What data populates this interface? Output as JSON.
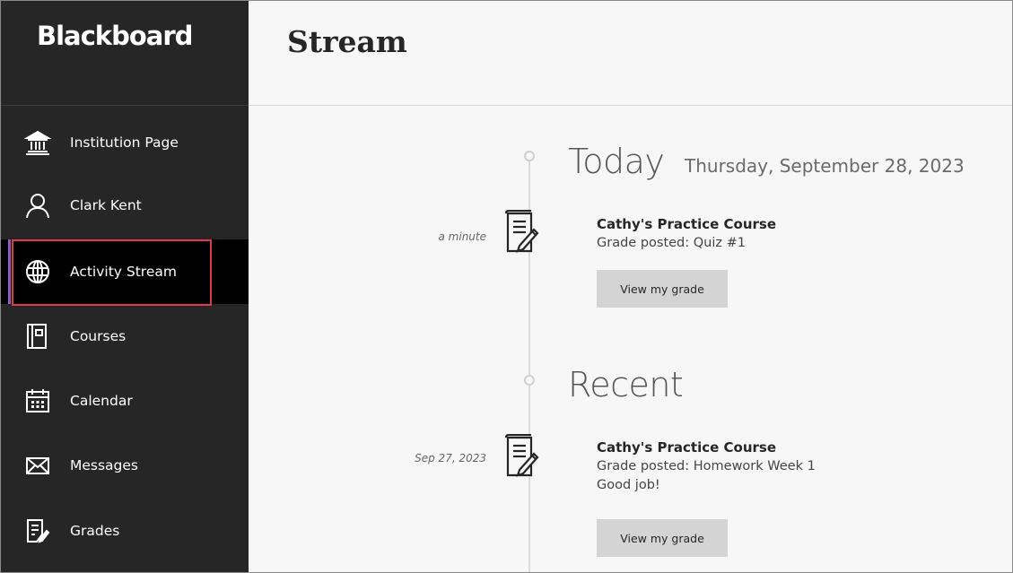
{
  "brand": {
    "name": "Blackboard"
  },
  "sidebar": {
    "items": [
      {
        "label": "Institution Page",
        "icon": "institution-icon"
      },
      {
        "label": "Clark Kent",
        "icon": "user-icon"
      },
      {
        "label": "Activity Stream",
        "icon": "globe-icon",
        "active": true
      },
      {
        "label": "Courses",
        "icon": "courses-icon"
      },
      {
        "label": "Calendar",
        "icon": "calendar-icon"
      },
      {
        "label": "Messages",
        "icon": "envelope-icon"
      },
      {
        "label": "Grades",
        "icon": "grades-icon"
      }
    ]
  },
  "header": {
    "title": "Stream"
  },
  "stream": {
    "today": {
      "title": "Today",
      "date": "Thursday, September 28, 2023",
      "item": {
        "time": "a minute",
        "course": "Cathy's Practice Course",
        "text": "Grade posted: Quiz #1",
        "button": "View my grade"
      }
    },
    "recent": {
      "title": "Recent",
      "item": {
        "time": "Sep 27, 2023",
        "course": "Cathy's Practice Course",
        "text": "Grade posted: Homework Week 1",
        "feedback": "Good job!",
        "button": "View my grade"
      }
    }
  },
  "colors": {
    "sidebar_bg": "#262626",
    "active_bg": "#000000",
    "active_indicator": "#8b5cc1",
    "highlight_border": "#e0394b",
    "button_bg": "#d4d4d4"
  }
}
